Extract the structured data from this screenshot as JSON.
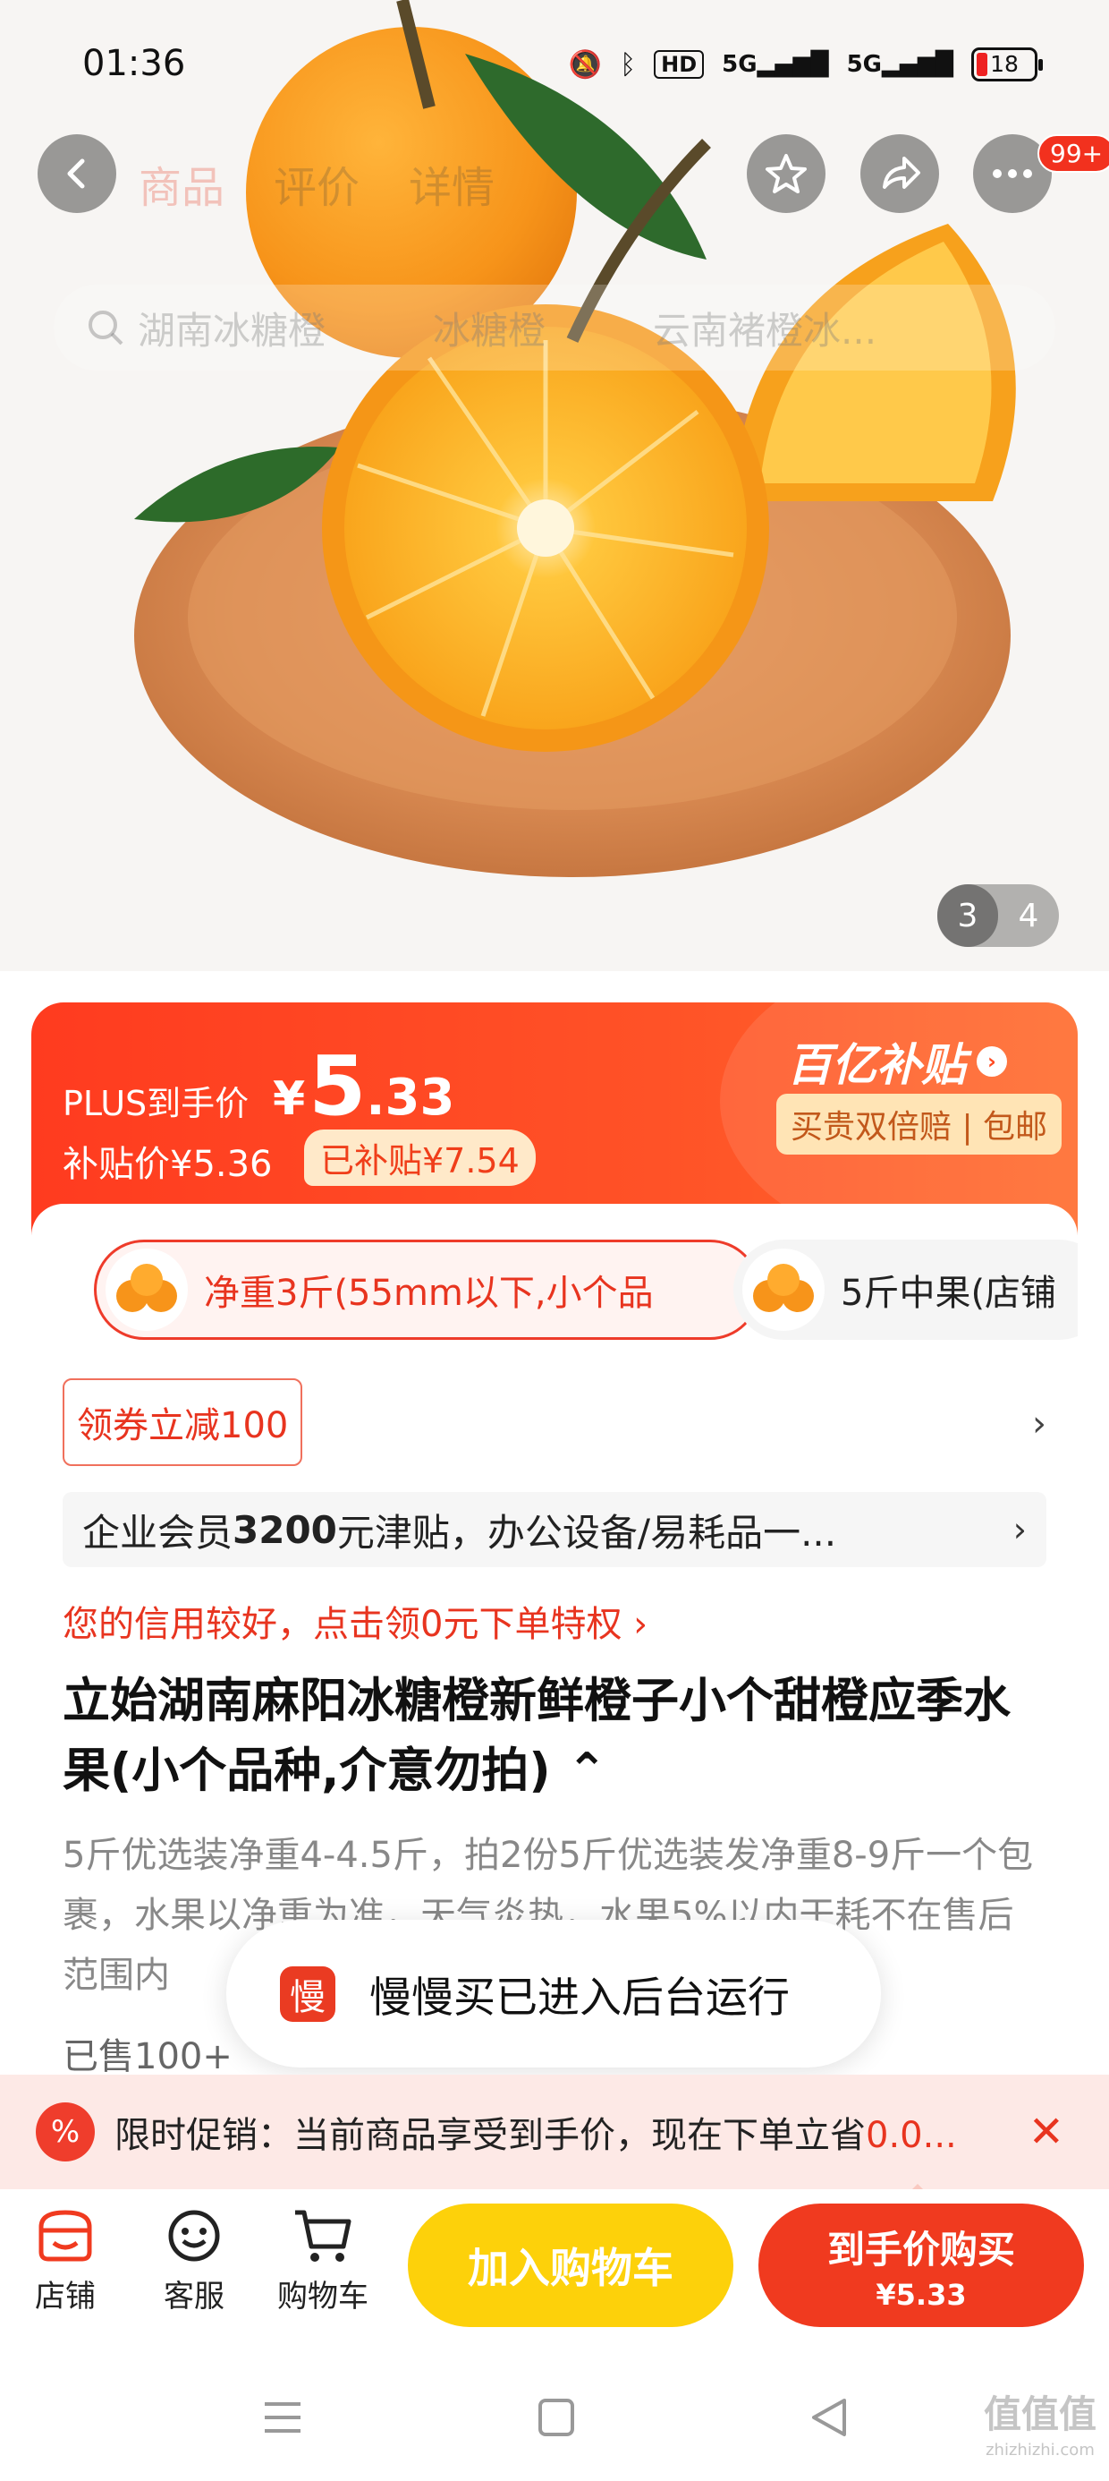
{
  "status": {
    "time": "01:36",
    "battery": "18",
    "hd": "HD",
    "net1": "5G",
    "net2": "5G"
  },
  "nav": {
    "tabs": [
      "商品",
      "评价",
      "详情"
    ],
    "badge": "99+"
  },
  "search": {
    "items": [
      "湖南冰糖橙",
      "冰糖橙",
      "云南褚橙冰..."
    ]
  },
  "pager": {
    "current": "3",
    "total": "4"
  },
  "price": {
    "plus_label": "PLUS到手价",
    "currency": "¥",
    "amount_int": "5",
    "amount_dec": ".33",
    "subsidy_label": "补贴价¥5.36",
    "subsidy_chip": "已补贴¥7.54",
    "brand": "百亿补贴",
    "brand_chip": "买贵双倍赔 | 包邮"
  },
  "variants": [
    {
      "label": "净重3斤(55mm以下,小个品"
    },
    {
      "label": "5斤中果(店铺"
    }
  ],
  "coupon": {
    "label": "领券立减100"
  },
  "member": {
    "prefix": "企业会员",
    "amount": "3200",
    "suffix": "元津贴，办公设备/易耗品一..."
  },
  "credit": "您的信用较好，点击领0元下单特权 ›",
  "title": "立始湖南麻阳冰糖橙新鲜橙子小个甜橙应季水果(小个品种,介意勿拍) ⌃",
  "desc": "5斤优选装净重4-4.5斤，拍2份5斤优选装发净重8-9斤一个包裹，水果以净重为准，天气炎热，水果5%以内干耗不在售后范围内",
  "sold": "已售100+",
  "toast": {
    "logo": "慢",
    "text": "慢慢买已进入后台运行"
  },
  "promo": {
    "icon": "%",
    "text_prefix": "限时促销：当前商品享受到手价，现在下单立省",
    "text_value": "0.0..."
  },
  "bottom": {
    "shop": "店铺",
    "service": "客服",
    "cart": "购物车",
    "add_cart": "加入购物车",
    "buy_line1": "到手价购买",
    "buy_line2": "¥5.33"
  },
  "watermark": {
    "main": "值值值",
    "sub": "zhizhizhi.com"
  },
  "colors": {
    "accent": "#f03a1f",
    "cart_yellow": "#fdd10a",
    "orange": "#f8a21a"
  }
}
